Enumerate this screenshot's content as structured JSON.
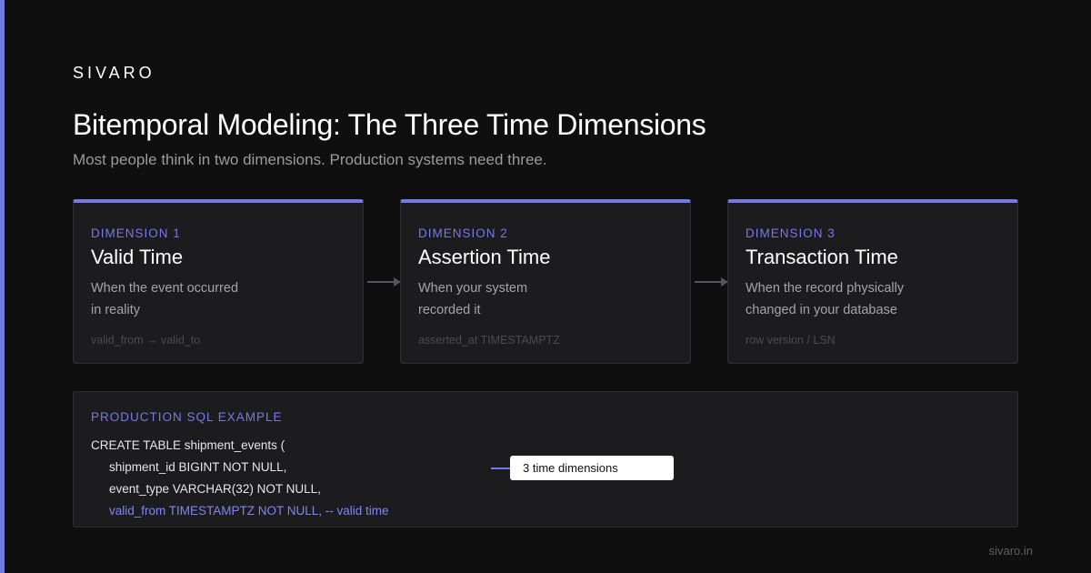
{
  "brand": "SIVARO",
  "title": "Bitemporal Modeling: The Three Time Dimensions",
  "subtitle": "Most people think in two dimensions. Production systems need three.",
  "cards": [
    {
      "dimension": "DIMENSION 1",
      "name": "Valid Time",
      "description": "When the event occurred\nin reality",
      "meta": "valid_from → valid_to"
    },
    {
      "dimension": "DIMENSION 2",
      "name": "Assertion Time",
      "description": "When your system\nrecorded it",
      "meta": "asserted_at TIMESTAMPTZ"
    },
    {
      "dimension": "DIMENSION 3",
      "name": "Transaction Time",
      "description": "When the record physically\nchanged in your database",
      "meta": "row version / LSN"
    }
  ],
  "sql": {
    "label": "PRODUCTION SQL EXAMPLE",
    "lines": [
      "CREATE TABLE shipment_events (",
      "shipment_id BIGINT NOT NULL,",
      "event_type VARCHAR(32) NOT NULL,",
      "valid_from TIMESTAMPTZ NOT NULL, -- valid time"
    ],
    "callout": "3 time dimensions"
  },
  "footer": "sivaro.in",
  "colors": {
    "accent": "#7479e8",
    "background": "#0f0f10",
    "card": "#1c1c1f"
  }
}
